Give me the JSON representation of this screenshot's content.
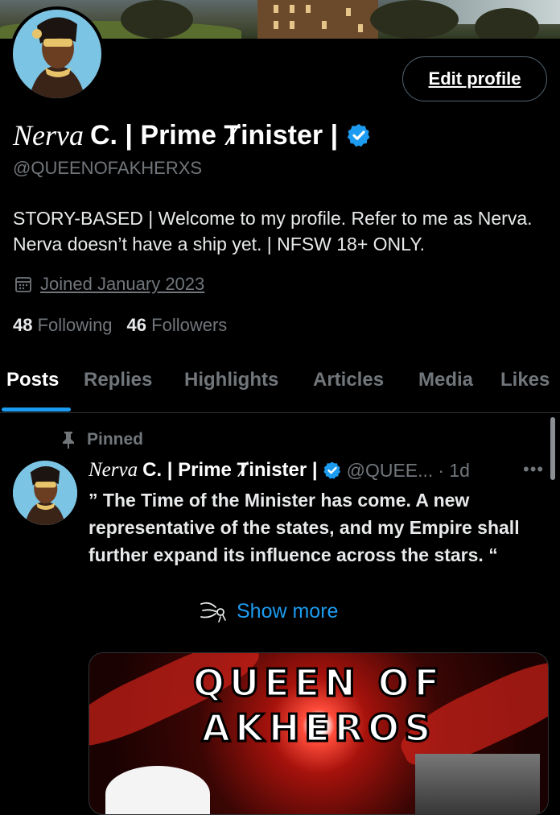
{
  "profile": {
    "name_script": "Nerva",
    "name_rest": "C. | Prime Ⱦinister |",
    "handle": "@QUEENOFAKHERXS",
    "bio": "STORY-BASED | Welcome to my profile. Refer to me as Nerva. Nerva doesn’t have a ship yet. | NFSW 18+ ONLY.",
    "joined": "Joined January 2023",
    "following_count": "48",
    "following_label": "Following",
    "followers_count": "46",
    "followers_label": "Followers",
    "edit_label": "Edit profile",
    "verified_color": "#1d9bf0"
  },
  "tabs": [
    {
      "label": "Posts",
      "active": true
    },
    {
      "label": "Replies"
    },
    {
      "label": "Highlights"
    },
    {
      "label": "Articles"
    },
    {
      "label": "Media"
    },
    {
      "label": "Likes"
    }
  ],
  "post": {
    "pinned_label": "Pinned",
    "author_script": "Nerva",
    "author_rest": "C. | Prime Ⱦinister |",
    "handle": "@QUEE...",
    "time": "· 1d",
    "more_icon": "more-dots-icon",
    "text": "” The Time of the Minister has come. A new representative of the states, and my Empire shall further expand its influence across the stars. “",
    "show_more": "Show more",
    "media_title_line1": "QUEEN OF",
    "media_title_line2": "AKHEROS"
  },
  "colors": {
    "accent": "#1d9bf0",
    "background": "#000000",
    "secondary_text": "#71767b"
  }
}
